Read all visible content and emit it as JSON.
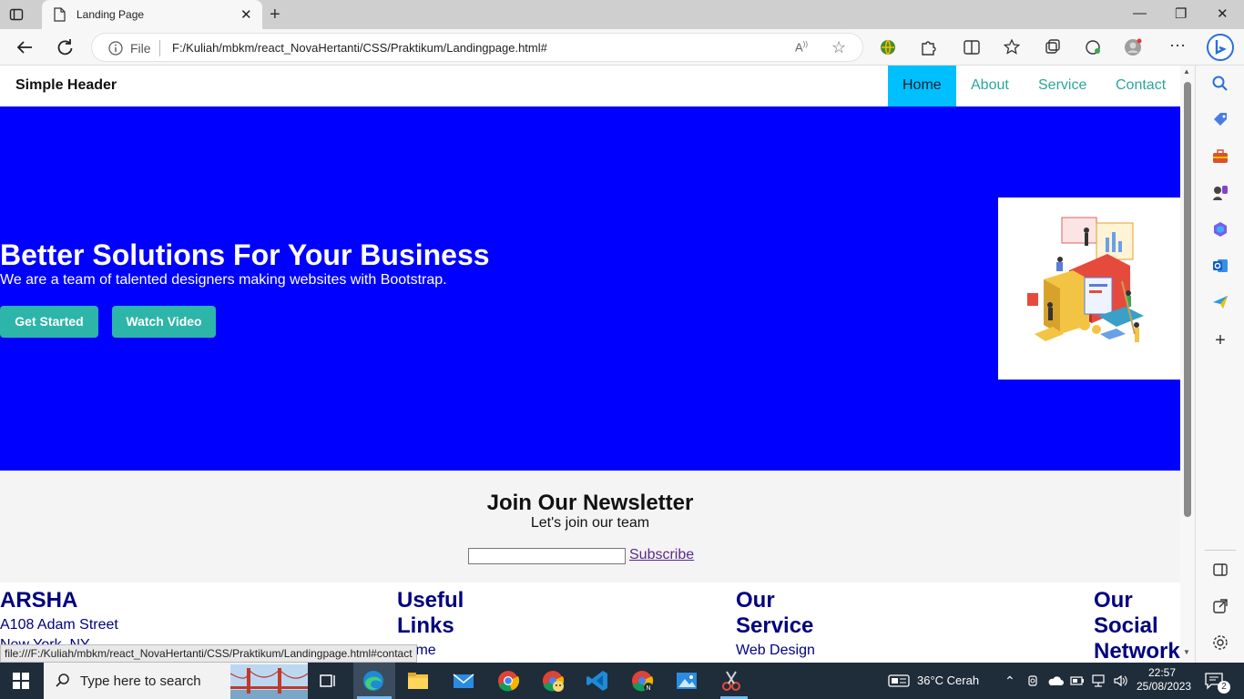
{
  "browser": {
    "tab_title": "Landing Page",
    "url_scheme_label": "File",
    "url": "F:/Kuliah/mbkm/react_NovaHertanti/CSS/Praktikum/Landingpage.html#",
    "status_url": "file:///F:/Kuliah/mbkm/react_NovaHertanti/CSS/Praktikum/Landingpage.html#contact"
  },
  "site": {
    "logo": "Simple Header",
    "nav": [
      "Home",
      "About",
      "Service",
      "Contact"
    ],
    "hero": {
      "title": "Better Solutions For Your Business",
      "subtitle": "We are a team of talented designers making websites with Bootstrap.",
      "btn_primary": "Get Started",
      "btn_secondary": "Watch Video"
    },
    "newsletter": {
      "title": "Join Our Newsletter",
      "subtitle": "Let's join our team",
      "subscribe": "Subscribe"
    },
    "footer": {
      "col1_title": "ARSHA",
      "col1_line1": "A108 Adam Street",
      "col1_line2": "New York, NY",
      "col2_title_a": "Useful",
      "col2_title_b": "Links",
      "col2_item": "Home",
      "col3_title_a": "Our",
      "col3_title_b": "Service",
      "col3_item": "Web Design",
      "col4_title_a": "Our",
      "col4_title_b": "Social",
      "col4_title_c": "Network"
    }
  },
  "taskbar": {
    "search_placeholder": "Type here to search",
    "weather": "36°C  Cerah",
    "time": "22:57",
    "date": "25/08/2023",
    "notifications": "2"
  },
  "colors": {
    "hero_bg": "#0000ff",
    "nav_active": "#00bfff",
    "accent_teal": "#2cb5a8",
    "footer_text": "#00007f"
  }
}
